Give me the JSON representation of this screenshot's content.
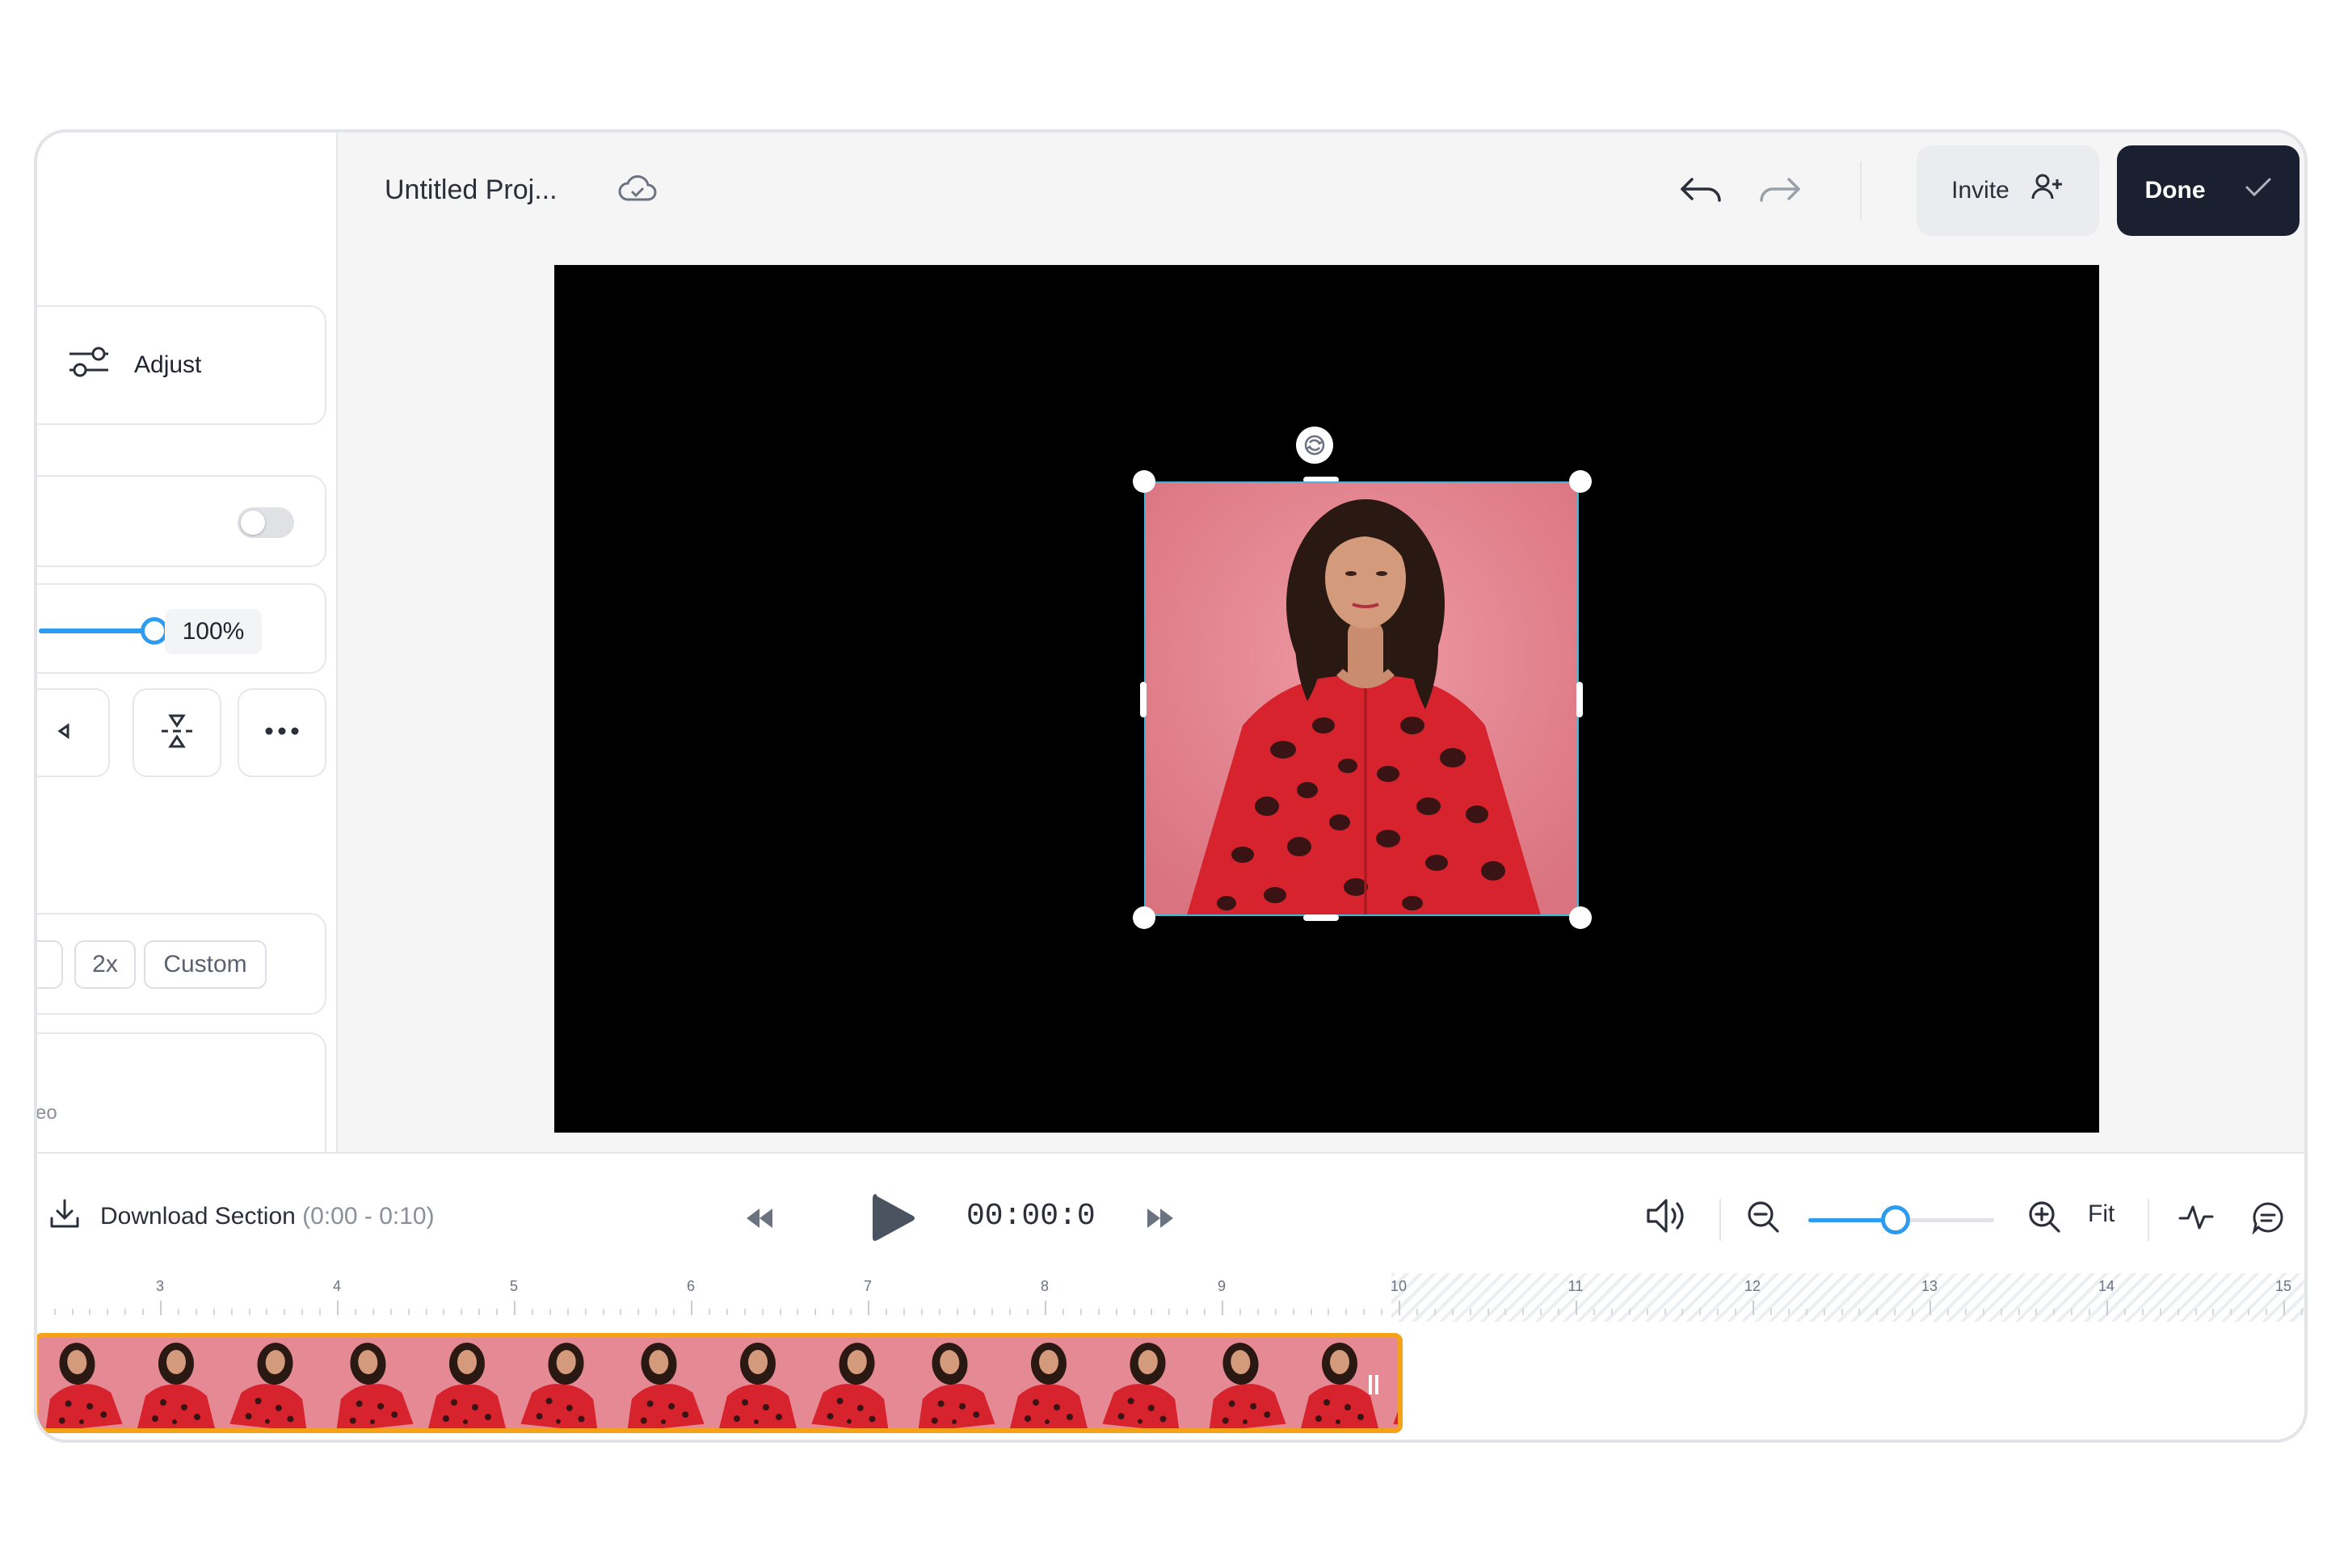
{
  "project": {
    "title": "Untitled Proj..."
  },
  "header": {
    "invite_label": "Invite",
    "done_label": "Done"
  },
  "sidebar": {
    "adjust_label": "Adjust",
    "toggle_on": false,
    "opacity": {
      "value": 1.0,
      "label": "100%"
    },
    "speed_options": [
      ":",
      "2x",
      "Custom"
    ],
    "partial_text": "eo"
  },
  "controls": {
    "download_label": "Download Section",
    "download_range": "(0:00 - 0:10)",
    "time": "00:00:0",
    "zoom_level": 0.45,
    "fit_label": "Fit"
  },
  "ruler": {
    "labels": [
      "3",
      "4",
      "5",
      "6",
      "7",
      "8",
      "9",
      "10",
      "11",
      "12",
      "13",
      "14",
      "15"
    ]
  },
  "colors": {
    "accent": "#2d9bf0",
    "clip_border": "#f5a21b",
    "done_bg": "#1a2030",
    "selection": "#3fb7d8",
    "photo_bg": "#e58a95",
    "dress": "#d6232d"
  },
  "icons": [
    "cloud-icon",
    "undo-icon",
    "redo-icon",
    "add-user-icon",
    "check-icon",
    "adjust-sliders-icon",
    "flip-icon",
    "align-icon",
    "more-icon",
    "rotate-icon",
    "download-icon",
    "rewind-icon",
    "play-icon",
    "fast-forward-icon",
    "volume-icon",
    "zoom-out-icon",
    "zoom-in-icon",
    "waveform-icon",
    "comment-icon"
  ]
}
